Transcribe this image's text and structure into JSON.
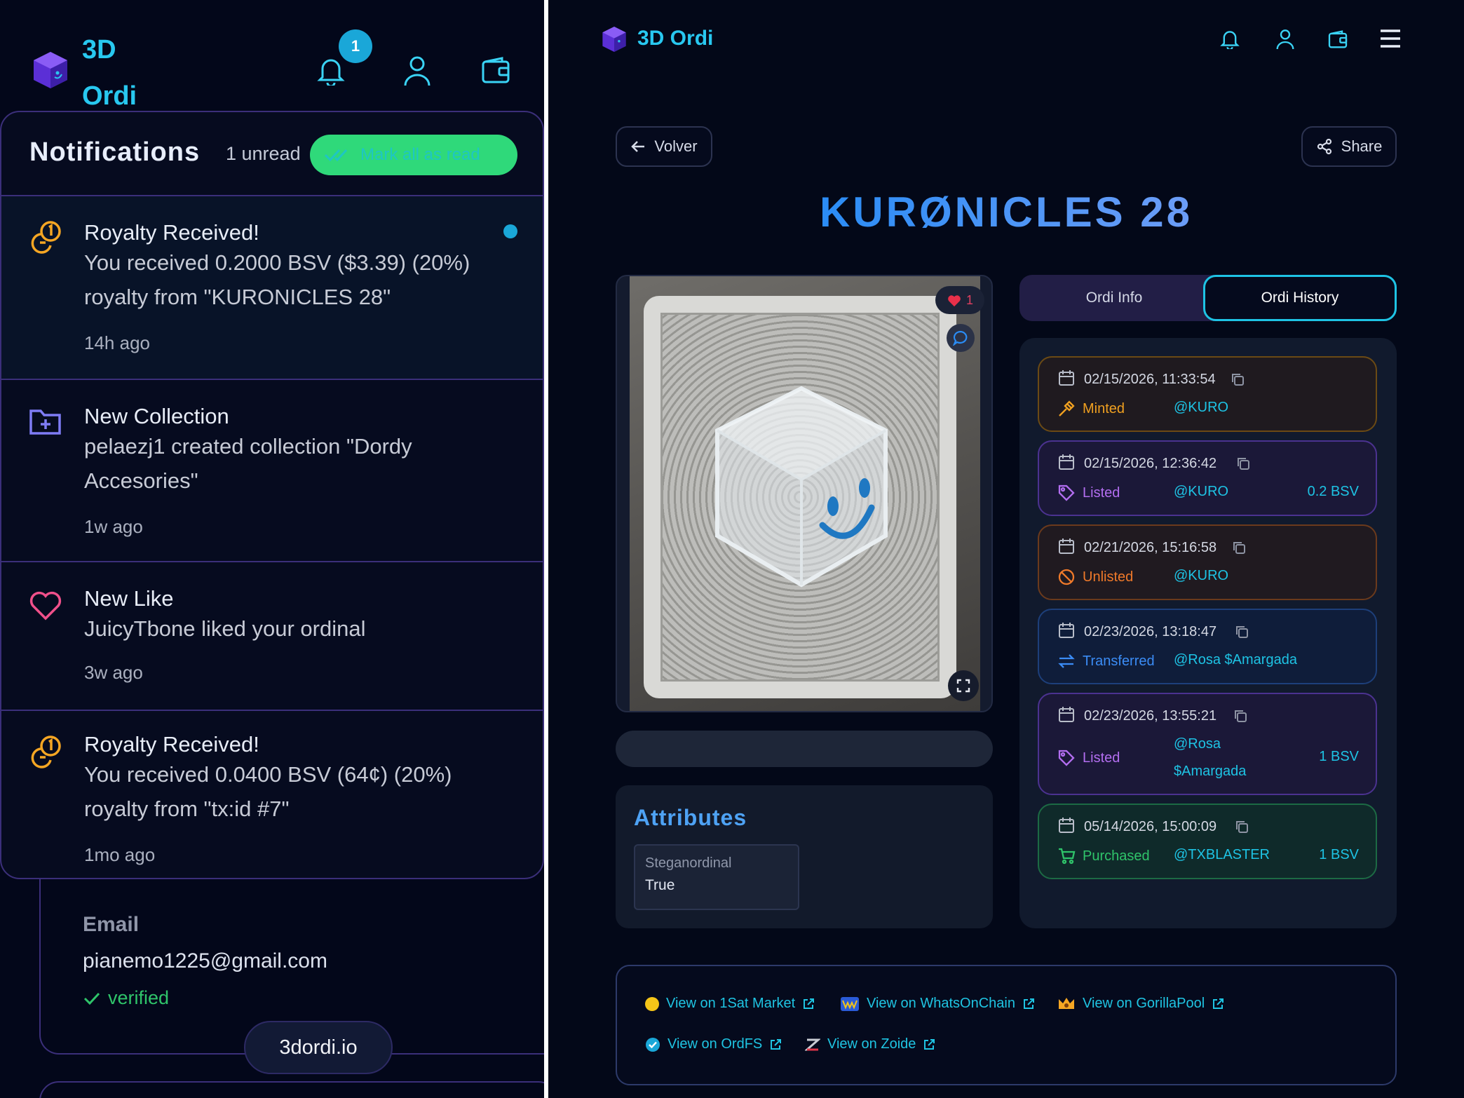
{
  "left": {
    "brand": "3D Ordi",
    "notification_badge": "1",
    "panel": {
      "title": "Notifications",
      "unread": "1 unread",
      "mark_all": "Mark all as read"
    },
    "notifications": [
      {
        "title": "Royalty Received!",
        "body": "You received 0.2000 BSV ($3.39) (20%) royalty from \"KURONICLES 28\"",
        "time": "14h ago",
        "icon": "royalty-coin-icon",
        "unread": true
      },
      {
        "title": "New Collection",
        "body": "pelaezj1 created collection \"Dordy Accesories\"",
        "time": "1w ago",
        "icon": "folder-plus-icon",
        "unread": false
      },
      {
        "title": "New Like",
        "body": "JuicyTbone liked your ordinal",
        "time": "3w ago",
        "icon": "heart-icon",
        "unread": false
      },
      {
        "title": "Royalty Received!",
        "body": "You received 0.0400 BSV (64¢) (20%) royalty from \"tx:id #7\"",
        "time": "1mo ago",
        "icon": "royalty-coin-icon",
        "unread": false
      }
    ],
    "email": {
      "label": "Email",
      "value": "pianemo1225@gmail.com",
      "status": "verified"
    },
    "site_pill": "3dordi.io"
  },
  "right": {
    "brand": "3D Ordi",
    "back_label": "Volver",
    "share_label": "Share",
    "title": "KURØNICLES 28",
    "like_count": "1",
    "attributes": {
      "title": "Attributes",
      "items": [
        {
          "name": "Steganordinal",
          "value": "True"
        }
      ]
    },
    "tabs": [
      {
        "label": "Ordi Info",
        "active": false
      },
      {
        "label": "Ordi History",
        "active": true
      }
    ],
    "history": [
      {
        "date": "02/15/2026, 11:33:54",
        "type": "Minted",
        "user": "@KURO",
        "amount": "",
        "color": "#f0a020"
      },
      {
        "date": "02/15/2026, 12:36:42",
        "type": "Listed",
        "user": "@KURO",
        "amount": "0.2 BSV",
        "color": "#b36ef0"
      },
      {
        "date": "02/21/2026, 15:16:58",
        "type": "Unlisted",
        "user": "@KURO",
        "amount": "",
        "color": "#f07a2a"
      },
      {
        "date": "02/23/2026, 13:18:47",
        "type": "Transferred",
        "user": "@Rosa $Amargada",
        "amount": "",
        "color": "#3b8cf5"
      },
      {
        "date": "02/23/2026, 13:55:21",
        "type": "Listed",
        "user_line1": "@Rosa",
        "user_line2": "$Amargada",
        "amount": "1 BSV",
        "color": "#b36ef0"
      },
      {
        "date": "05/14/2026, 15:00:09",
        "type": "Purchased",
        "user": "@TXBLASTER",
        "amount": "1 BSV",
        "color": "#2fc46a"
      }
    ],
    "links": [
      {
        "label": "View on 1Sat Market",
        "icon": "1sat-dot-icon"
      },
      {
        "label": "View on WhatsOnChain",
        "icon": "whatsonchain-icon"
      },
      {
        "label": "View on GorillaPool",
        "icon": "gorillapool-icon"
      },
      {
        "label": "View on OrdFS",
        "icon": "ordfs-check-icon"
      },
      {
        "label": "View on Zoide",
        "icon": "zoide-icon"
      }
    ]
  }
}
